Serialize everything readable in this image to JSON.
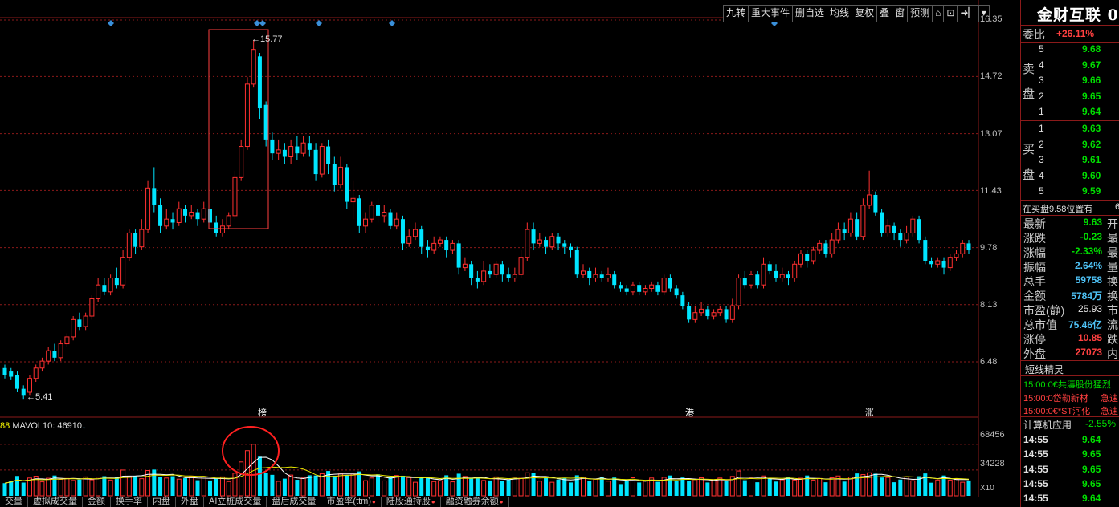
{
  "toolbar": {
    "buttons": [
      "九转",
      "重大事件",
      "删自选",
      "均线",
      "复权",
      "叠",
      "窗",
      "预测",
      "⌂",
      "⊡",
      "➜▏",
      "▾"
    ]
  },
  "price_axis": [
    "16.35",
    "14.72",
    "13.07",
    "11.43",
    "9.78",
    "8.13",
    "6.48"
  ],
  "extremes": {
    "high": "15.77",
    "low": "5.41"
  },
  "events": [
    "榜",
    "港",
    "涨"
  ],
  "volume": {
    "header_prefix": "88",
    "header": "MAVOL10: 46910",
    "arrow": "↓",
    "axis": [
      "68456",
      "34228"
    ],
    "multiplier": "X10"
  },
  "bottom_tabs": [
    "交量",
    "虚拟成交量",
    "金额",
    "换手率",
    "内盘",
    "外盘",
    "AI立桩成交量",
    "盘后成交量",
    "市盈率(ttm)",
    "陆股通持股",
    "融资融券余额"
  ],
  "colors": {
    "up": "#ff3030",
    "down": "#00e5ff",
    "grid": "#8b1a1a",
    "ma_yellow": "#e6e600",
    "ma_white": "#ffffff"
  },
  "stock": {
    "name": "金财互联 0",
    "weibi": {
      "label": "委比",
      "value": "+26.11%"
    },
    "sell_label": "卖盘",
    "buy_label": "买盘",
    "sell": [
      {
        "level": "5",
        "price": "9.68"
      },
      {
        "level": "4",
        "price": "9.67"
      },
      {
        "level": "3",
        "price": "9.66"
      },
      {
        "level": "2",
        "price": "9.65"
      },
      {
        "level": "1",
        "price": "9.64"
      }
    ],
    "buy": [
      {
        "level": "1",
        "price": "9.63"
      },
      {
        "level": "2",
        "price": "9.62"
      },
      {
        "level": "3",
        "price": "9.61"
      },
      {
        "level": "4",
        "price": "9.60"
      },
      {
        "level": "5",
        "price": "9.59"
      }
    ],
    "notice": "在买盘9.58位置有",
    "notice_tail": "6",
    "stats": [
      {
        "label": "最新",
        "value": "9.63",
        "cls": "g",
        "tail": "开"
      },
      {
        "label": "涨跌",
        "value": "-0.23",
        "cls": "g",
        "tail": "最"
      },
      {
        "label": "涨幅",
        "value": "-2.33%",
        "cls": "g",
        "tail": "最"
      },
      {
        "label": "振幅",
        "value": "2.64%",
        "cls": "c",
        "tail": "量"
      },
      {
        "label": "总手",
        "value": "59758",
        "cls": "c",
        "tail": "换"
      },
      {
        "label": "金额",
        "value": "5784万",
        "cls": "c",
        "tail": "换"
      },
      {
        "label": "市盈(静)",
        "value": "25.93",
        "cls": "w",
        "tail": "市"
      },
      {
        "label": "总市值",
        "value": "75.46亿",
        "cls": "c",
        "tail": "流"
      },
      {
        "label": "涨停",
        "value": "10.85",
        "cls": "r",
        "tail": "跌"
      },
      {
        "label": "外盘",
        "value": "27073",
        "cls": "r",
        "tail": "内"
      }
    ],
    "short_title": "短线精灵",
    "short_items": [
      {
        "text": "15:00:0€共濤股份猛烈",
        "color": "#00e000"
      },
      {
        "text": "15:00:0岱勒新材",
        "tail": "急速",
        "color": "#ff4040"
      },
      {
        "text": "15:00:0€*ST河化",
        "tail": "急速",
        "color": "#ff4040"
      }
    ],
    "sector": {
      "name": "计算机应用",
      "change": "-2.55%"
    },
    "ticks": [
      {
        "time": "14:55",
        "price": "9.64"
      },
      {
        "time": "14:55",
        "price": "9.65"
      },
      {
        "time": "14:55",
        "price": "9.65"
      },
      {
        "time": "14:55",
        "price": "9.65"
      },
      {
        "time": "14:55",
        "price": "9.64"
      }
    ]
  },
  "chart_data": {
    "type": "candlestick",
    "y_ticks": [
      16.35,
      14.72,
      13.07,
      11.43,
      9.78,
      8.13,
      6.48
    ],
    "ylim": [
      4.8,
      16.35
    ],
    "volume_ylim": [
      0,
      80000
    ],
    "candles": [
      {
        "o": 6.3,
        "c": 6.1,
        "h": 6.4,
        "l": 6.0
      },
      {
        "o": 6.2,
        "c": 6.05,
        "h": 6.3,
        "l": 5.95
      },
      {
        "o": 6.1,
        "c": 5.7,
        "h": 6.2,
        "l": 5.6
      },
      {
        "o": 5.7,
        "c": 5.5,
        "h": 5.8,
        "l": 5.41
      },
      {
        "o": 5.6,
        "c": 6.0,
        "h": 6.1,
        "l": 5.5
      },
      {
        "o": 6.0,
        "c": 6.3,
        "h": 6.4,
        "l": 5.9
      },
      {
        "o": 6.3,
        "c": 6.5,
        "h": 6.6,
        "l": 6.2
      },
      {
        "o": 6.5,
        "c": 6.8,
        "h": 6.9,
        "l": 6.4
      },
      {
        "o": 6.8,
        "c": 6.6,
        "h": 7.0,
        "l": 6.5
      },
      {
        "o": 6.6,
        "c": 7.0,
        "h": 7.1,
        "l": 6.5
      },
      {
        "o": 7.0,
        "c": 7.2,
        "h": 7.3,
        "l": 6.9
      },
      {
        "o": 7.2,
        "c": 7.7,
        "h": 7.8,
        "l": 7.1
      },
      {
        "o": 7.7,
        "c": 7.5,
        "h": 7.9,
        "l": 7.4
      },
      {
        "o": 7.5,
        "c": 7.8,
        "h": 7.9,
        "l": 7.4
      },
      {
        "o": 7.8,
        "c": 8.3,
        "h": 8.4,
        "l": 7.7
      },
      {
        "o": 8.3,
        "c": 8.7,
        "h": 8.9,
        "l": 8.2
      },
      {
        "o": 8.7,
        "c": 8.5,
        "h": 8.9,
        "l": 8.4
      },
      {
        "o": 8.5,
        "c": 8.9,
        "h": 9.0,
        "l": 8.4
      },
      {
        "o": 8.9,
        "c": 8.7,
        "h": 9.2,
        "l": 8.6
      },
      {
        "o": 8.7,
        "c": 9.5,
        "h": 9.7,
        "l": 8.6
      },
      {
        "o": 9.5,
        "c": 10.2,
        "h": 10.3,
        "l": 9.4
      },
      {
        "o": 10.2,
        "c": 9.8,
        "h": 10.3,
        "l": 9.6
      },
      {
        "o": 9.8,
        "c": 10.3,
        "h": 10.6,
        "l": 9.7
      },
      {
        "o": 10.3,
        "c": 11.5,
        "h": 11.7,
        "l": 10.2
      },
      {
        "o": 11.5,
        "c": 11.0,
        "h": 12.1,
        "l": 10.8
      },
      {
        "o": 11.0,
        "c": 10.4,
        "h": 11.2,
        "l": 10.2
      },
      {
        "o": 10.4,
        "c": 10.6,
        "h": 10.9,
        "l": 10.3
      },
      {
        "o": 10.6,
        "c": 10.5,
        "h": 10.8,
        "l": 10.3
      },
      {
        "o": 10.5,
        "c": 10.9,
        "h": 11.1,
        "l": 10.4
      },
      {
        "o": 10.9,
        "c": 10.7,
        "h": 11.0,
        "l": 10.5
      },
      {
        "o": 10.7,
        "c": 10.8,
        "h": 11.0,
        "l": 10.6
      },
      {
        "o": 10.8,
        "c": 10.6,
        "h": 10.9,
        "l": 10.4
      },
      {
        "o": 10.6,
        "c": 10.9,
        "h": 11.1,
        "l": 10.5
      },
      {
        "o": 10.9,
        "c": 10.5,
        "h": 11.0,
        "l": 10.3
      },
      {
        "o": 10.5,
        "c": 10.2,
        "h": 10.7,
        "l": 10.1
      },
      {
        "o": 10.2,
        "c": 10.4,
        "h": 10.6,
        "l": 10.1
      },
      {
        "o": 10.4,
        "c": 10.7,
        "h": 10.8,
        "l": 10.3
      },
      {
        "o": 10.7,
        "c": 11.8,
        "h": 12.0,
        "l": 10.6
      },
      {
        "o": 11.8,
        "c": 12.7,
        "h": 12.9,
        "l": 11.7
      },
      {
        "o": 12.7,
        "c": 14.5,
        "h": 14.7,
        "l": 12.6
      },
      {
        "o": 14.5,
        "c": 15.5,
        "h": 15.77,
        "l": 14.4
      },
      {
        "o": 15.3,
        "c": 13.8,
        "h": 15.4,
        "l": 13.5
      },
      {
        "o": 13.9,
        "c": 12.9,
        "h": 14.0,
        "l": 12.7
      },
      {
        "o": 12.9,
        "c": 12.5,
        "h": 13.1,
        "l": 12.3
      },
      {
        "o": 12.5,
        "c": 12.6,
        "h": 12.9,
        "l": 12.3
      },
      {
        "o": 12.6,
        "c": 12.4,
        "h": 12.8,
        "l": 12.2
      },
      {
        "o": 12.4,
        "c": 12.7,
        "h": 12.9,
        "l": 12.2
      },
      {
        "o": 12.7,
        "c": 12.5,
        "h": 13.0,
        "l": 12.3
      },
      {
        "o": 12.5,
        "c": 12.8,
        "h": 13.0,
        "l": 12.4
      },
      {
        "o": 12.8,
        "c": 12.6,
        "h": 13.0,
        "l": 12.4
      },
      {
        "o": 12.6,
        "c": 11.9,
        "h": 12.8,
        "l": 11.7
      },
      {
        "o": 11.9,
        "c": 12.7,
        "h": 12.8,
        "l": 11.8
      },
      {
        "o": 12.7,
        "c": 12.2,
        "h": 12.9,
        "l": 11.9
      },
      {
        "o": 12.2,
        "c": 11.6,
        "h": 12.4,
        "l": 11.4
      },
      {
        "o": 11.6,
        "c": 12.1,
        "h": 12.4,
        "l": 11.5
      },
      {
        "o": 12.1,
        "c": 11.1,
        "h": 12.2,
        "l": 10.9
      },
      {
        "o": 11.1,
        "c": 11.2,
        "h": 11.7,
        "l": 10.6
      },
      {
        "o": 11.2,
        "c": 10.4,
        "h": 11.3,
        "l": 10.2
      },
      {
        "o": 10.4,
        "c": 10.6,
        "h": 10.8,
        "l": 10.2
      },
      {
        "o": 10.6,
        "c": 11.0,
        "h": 11.1,
        "l": 10.5
      },
      {
        "o": 11.0,
        "c": 10.7,
        "h": 11.2,
        "l": 10.5
      },
      {
        "o": 10.7,
        "c": 10.8,
        "h": 11.0,
        "l": 10.5
      },
      {
        "o": 10.8,
        "c": 10.4,
        "h": 10.9,
        "l": 10.3
      },
      {
        "o": 10.4,
        "c": 10.6,
        "h": 10.8,
        "l": 10.3
      },
      {
        "o": 10.6,
        "c": 9.9,
        "h": 10.7,
        "l": 9.7
      },
      {
        "o": 9.9,
        "c": 10.1,
        "h": 10.3,
        "l": 9.8
      },
      {
        "o": 10.1,
        "c": 10.3,
        "h": 10.5,
        "l": 10.0
      },
      {
        "o": 10.3,
        "c": 9.8,
        "h": 10.4,
        "l": 9.6
      },
      {
        "o": 9.8,
        "c": 9.7,
        "h": 10.0,
        "l": 9.5
      },
      {
        "o": 9.7,
        "c": 9.9,
        "h": 10.1,
        "l": 9.6
      },
      {
        "o": 9.9,
        "c": 10.0,
        "h": 10.1,
        "l": 9.8
      },
      {
        "o": 10.0,
        "c": 9.7,
        "h": 10.1,
        "l": 9.5
      },
      {
        "o": 9.7,
        "c": 9.9,
        "h": 10.0,
        "l": 9.6
      },
      {
        "o": 9.9,
        "c": 9.2,
        "h": 10.0,
        "l": 9.0
      },
      {
        "o": 9.2,
        "c": 9.3,
        "h": 9.5,
        "l": 9.1
      },
      {
        "o": 9.3,
        "c": 8.9,
        "h": 9.4,
        "l": 8.7
      },
      {
        "o": 8.9,
        "c": 8.8,
        "h": 9.1,
        "l": 8.6
      },
      {
        "o": 8.8,
        "c": 9.1,
        "h": 9.4,
        "l": 8.7
      },
      {
        "o": 9.1,
        "c": 9.0,
        "h": 9.3,
        "l": 8.9
      },
      {
        "o": 9.0,
        "c": 9.3,
        "h": 9.4,
        "l": 8.9
      },
      {
        "o": 9.3,
        "c": 9.0,
        "h": 9.4,
        "l": 8.8
      },
      {
        "o": 9.0,
        "c": 8.9,
        "h": 9.2,
        "l": 8.8
      },
      {
        "o": 8.9,
        "c": 9.0,
        "h": 9.2,
        "l": 8.8
      },
      {
        "o": 9.0,
        "c": 9.5,
        "h": 9.7,
        "l": 8.9
      },
      {
        "o": 9.5,
        "c": 10.3,
        "h": 10.5,
        "l": 9.4
      },
      {
        "o": 10.3,
        "c": 9.9,
        "h": 10.5,
        "l": 9.7
      },
      {
        "o": 9.9,
        "c": 10.0,
        "h": 10.2,
        "l": 9.8
      },
      {
        "o": 10.0,
        "c": 9.8,
        "h": 10.1,
        "l": 9.6
      },
      {
        "o": 9.8,
        "c": 10.1,
        "h": 10.2,
        "l": 9.7
      },
      {
        "o": 10.1,
        "c": 9.9,
        "h": 10.2,
        "l": 9.7
      },
      {
        "o": 9.9,
        "c": 9.8,
        "h": 10.0,
        "l": 9.6
      },
      {
        "o": 9.8,
        "c": 9.7,
        "h": 9.9,
        "l": 9.5
      },
      {
        "o": 9.7,
        "c": 9.0,
        "h": 9.8,
        "l": 8.9
      },
      {
        "o": 9.0,
        "c": 9.1,
        "h": 9.3,
        "l": 8.9
      },
      {
        "o": 9.1,
        "c": 8.9,
        "h": 9.2,
        "l": 8.7
      },
      {
        "o": 8.9,
        "c": 9.0,
        "h": 9.2,
        "l": 8.8
      },
      {
        "o": 9.0,
        "c": 8.9,
        "h": 9.1,
        "l": 8.8
      },
      {
        "o": 8.9,
        "c": 9.0,
        "h": 9.2,
        "l": 8.8
      },
      {
        "o": 9.0,
        "c": 8.7,
        "h": 9.1,
        "l": 8.6
      },
      {
        "o": 8.7,
        "c": 8.6,
        "h": 8.8,
        "l": 8.5
      },
      {
        "o": 8.6,
        "c": 8.5,
        "h": 8.7,
        "l": 8.4
      },
      {
        "o": 8.5,
        "c": 8.7,
        "h": 8.8,
        "l": 8.4
      },
      {
        "o": 8.7,
        "c": 8.5,
        "h": 8.8,
        "l": 8.4
      },
      {
        "o": 8.5,
        "c": 8.6,
        "h": 8.7,
        "l": 8.4
      },
      {
        "o": 8.6,
        "c": 8.7,
        "h": 8.8,
        "l": 8.5
      },
      {
        "o": 8.7,
        "c": 8.5,
        "h": 8.8,
        "l": 8.4
      },
      {
        "o": 8.5,
        "c": 8.9,
        "h": 9.0,
        "l": 8.4
      },
      {
        "o": 8.9,
        "c": 8.6,
        "h": 9.0,
        "l": 8.5
      },
      {
        "o": 8.6,
        "c": 8.4,
        "h": 8.7,
        "l": 8.3
      },
      {
        "o": 8.4,
        "c": 8.1,
        "h": 8.5,
        "l": 8.0
      },
      {
        "o": 8.1,
        "c": 7.7,
        "h": 8.2,
        "l": 7.6
      },
      {
        "o": 7.7,
        "c": 7.9,
        "h": 8.1,
        "l": 7.6
      },
      {
        "o": 7.9,
        "c": 8.0,
        "h": 8.2,
        "l": 7.8
      },
      {
        "o": 8.0,
        "c": 7.8,
        "h": 8.1,
        "l": 7.7
      },
      {
        "o": 7.8,
        "c": 7.9,
        "h": 8.0,
        "l": 7.7
      },
      {
        "o": 7.9,
        "c": 8.0,
        "h": 8.1,
        "l": 7.8
      },
      {
        "o": 8.0,
        "c": 7.7,
        "h": 8.1,
        "l": 7.6
      },
      {
        "o": 7.7,
        "c": 8.1,
        "h": 8.3,
        "l": 7.6
      },
      {
        "o": 8.1,
        "c": 8.9,
        "h": 9.0,
        "l": 8.0
      },
      {
        "o": 8.9,
        "c": 8.7,
        "h": 9.1,
        "l": 8.6
      },
      {
        "o": 8.7,
        "c": 9.0,
        "h": 9.1,
        "l": 8.6
      },
      {
        "o": 9.0,
        "c": 8.7,
        "h": 9.1,
        "l": 8.6
      },
      {
        "o": 8.7,
        "c": 9.3,
        "h": 9.5,
        "l": 8.6
      },
      {
        "o": 9.3,
        "c": 9.1,
        "h": 9.4,
        "l": 9.0
      },
      {
        "o": 9.1,
        "c": 8.9,
        "h": 9.3,
        "l": 8.8
      },
      {
        "o": 8.9,
        "c": 9.0,
        "h": 9.2,
        "l": 8.8
      },
      {
        "o": 9.0,
        "c": 8.9,
        "h": 9.1,
        "l": 8.7
      },
      {
        "o": 8.9,
        "c": 9.3,
        "h": 9.4,
        "l": 8.8
      },
      {
        "o": 9.3,
        "c": 9.6,
        "h": 9.7,
        "l": 9.2
      },
      {
        "o": 9.6,
        "c": 9.4,
        "h": 9.7,
        "l": 9.2
      },
      {
        "o": 9.4,
        "c": 9.7,
        "h": 9.8,
        "l": 9.3
      },
      {
        "o": 9.7,
        "c": 9.9,
        "h": 10.0,
        "l": 9.6
      },
      {
        "o": 9.9,
        "c": 9.6,
        "h": 10.0,
        "l": 9.5
      },
      {
        "o": 9.6,
        "c": 10.0,
        "h": 10.2,
        "l": 9.5
      },
      {
        "o": 10.0,
        "c": 10.3,
        "h": 10.5,
        "l": 9.9
      },
      {
        "o": 10.3,
        "c": 10.2,
        "h": 10.5,
        "l": 10.0
      },
      {
        "o": 10.2,
        "c": 10.6,
        "h": 10.8,
        "l": 10.1
      },
      {
        "o": 10.6,
        "c": 10.1,
        "h": 10.8,
        "l": 10.0
      },
      {
        "o": 10.1,
        "c": 11.0,
        "h": 11.2,
        "l": 10.0
      },
      {
        "o": 11.0,
        "c": 11.3,
        "h": 12.0,
        "l": 10.9
      },
      {
        "o": 11.3,
        "c": 10.8,
        "h": 11.4,
        "l": 10.7
      },
      {
        "o": 10.8,
        "c": 10.2,
        "h": 10.9,
        "l": 10.1
      },
      {
        "o": 10.2,
        "c": 10.4,
        "h": 10.6,
        "l": 10.1
      },
      {
        "o": 10.4,
        "c": 10.2,
        "h": 10.5,
        "l": 10.0
      },
      {
        "o": 10.2,
        "c": 10.0,
        "h": 10.3,
        "l": 9.8
      },
      {
        "o": 10.0,
        "c": 10.2,
        "h": 10.4,
        "l": 9.9
      },
      {
        "o": 10.2,
        "c": 10.6,
        "h": 10.7,
        "l": 10.1
      },
      {
        "o": 10.6,
        "c": 10.0,
        "h": 10.7,
        "l": 9.9
      },
      {
        "o": 10.0,
        "c": 9.4,
        "h": 10.1,
        "l": 9.3
      },
      {
        "o": 9.4,
        "c": 9.3,
        "h": 9.5,
        "l": 9.2
      },
      {
        "o": 9.3,
        "c": 9.4,
        "h": 9.5,
        "l": 9.2
      },
      {
        "o": 9.4,
        "c": 9.2,
        "h": 9.5,
        "l": 9.0
      },
      {
        "o": 9.2,
        "c": 9.5,
        "h": 9.6,
        "l": 9.1
      },
      {
        "o": 9.5,
        "c": 9.6,
        "h": 9.7,
        "l": 9.4
      },
      {
        "o": 9.6,
        "c": 9.9,
        "h": 10.0,
        "l": 9.5
      },
      {
        "o": 9.9,
        "c": 9.7,
        "h": 10.0,
        "l": 9.6
      }
    ]
  }
}
